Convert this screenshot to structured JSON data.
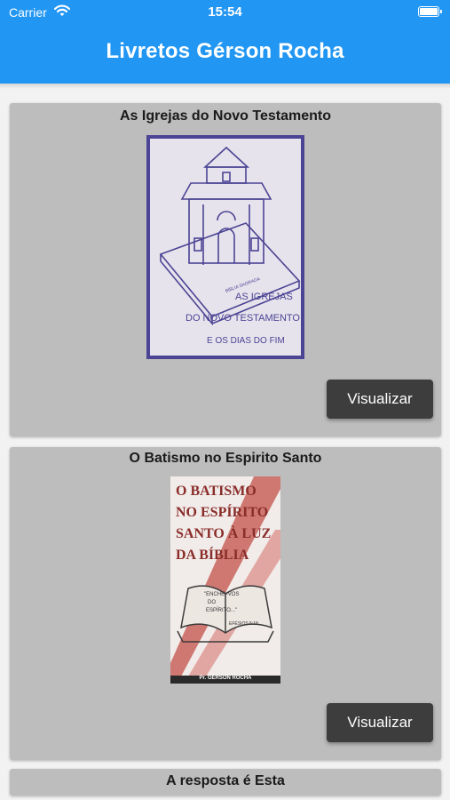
{
  "status_bar": {
    "carrier": "Carrier",
    "time": "15:54"
  },
  "header": {
    "title": "Livretos Gérson Rocha"
  },
  "books": [
    {
      "title": "As Igrejas do Novo Testamento",
      "button_label": "Visualizar",
      "cover_text": [
        "AS IGREJAS",
        "DO NOVO TESTAMENTO",
        "E OS DIAS DO FIM"
      ],
      "cover_bible_label": "BÍBLIA SAGRADA"
    },
    {
      "title": "O Batismo no Espirito Santo",
      "button_label": "Visualizar",
      "cover_text": [
        "O BATISMO",
        "NO ESPÍRITO",
        "SANTO À LUZ",
        "DA BÍBLIA"
      ],
      "cover_quote": [
        "\"ENCHEI-VOS",
        "DO",
        "ESPÍRITO...\"",
        "EFÉSIOS 5:18"
      ],
      "cover_author": "Pr. GÉRSON ROCHA"
    },
    {
      "title": "A resposta é Esta"
    }
  ]
}
